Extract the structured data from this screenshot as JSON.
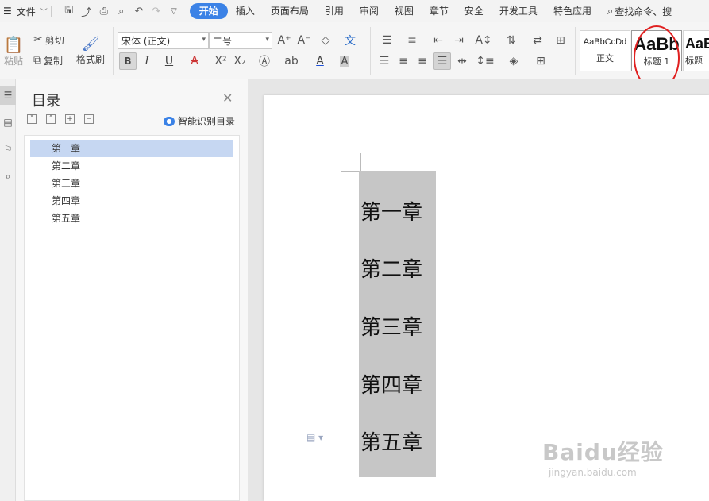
{
  "menubar": {
    "file_label": "文件",
    "tabs": [
      "开始",
      "插入",
      "页面布局",
      "引用",
      "审阅",
      "视图",
      "章节",
      "安全",
      "开发工具",
      "特色应用"
    ],
    "search_label": "查找命令、搜"
  },
  "ribbon": {
    "paste_label": "粘贴",
    "cut_label": "剪切",
    "copy_label": "复制",
    "format_painter_label": "格式刷",
    "font_name": "宋体 (正文)",
    "font_size": "二号",
    "styles": [
      {
        "sample": "AaBbCcDd",
        "label": "正文"
      },
      {
        "sample": "AaBb",
        "label": "标题 1"
      },
      {
        "sample": "AaB",
        "label": "标题"
      }
    ]
  },
  "toc": {
    "title": "目录",
    "smart_label": "智能识别目录",
    "items": [
      "第一章",
      "第二章",
      "第三章",
      "第四章",
      "第五章"
    ]
  },
  "document": {
    "headings": [
      "第一章",
      "第二章",
      "第三章",
      "第四章",
      "第五章"
    ]
  },
  "watermark": {
    "main": "Baidu经验",
    "sub": "jingyan.baidu.com"
  }
}
